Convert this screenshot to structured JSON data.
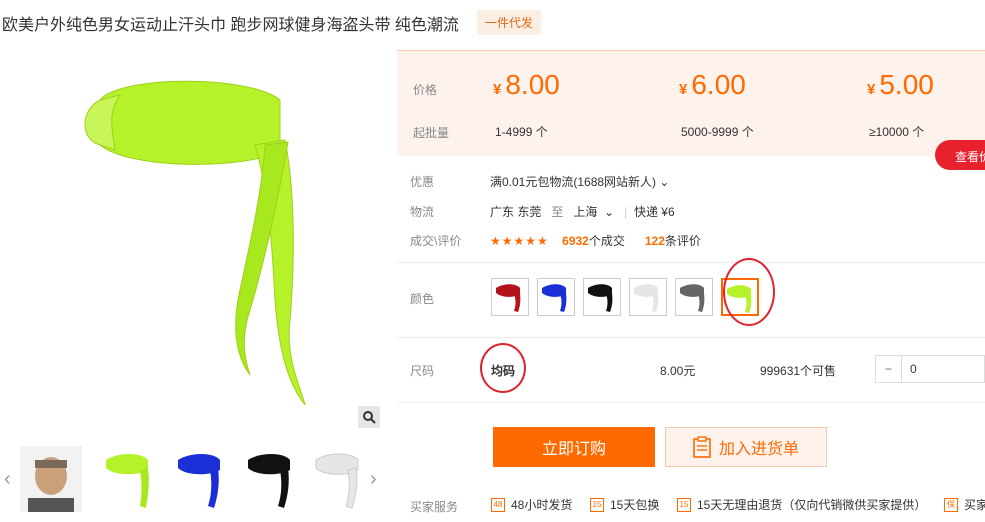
{
  "header": {
    "title": "欧美户外纯色男女运动止汗头巾 跑步网球健身海盗头带 纯色潮流",
    "badge": "一件代发"
  },
  "colors": {
    "accent": "#ff6a00",
    "highlight_circle": "#e0222d",
    "product_green": "#b6f22a"
  },
  "pricing": {
    "price_label": "价格",
    "moq_label": "起批量",
    "currency": "¥",
    "tiers": [
      {
        "price": "8.00",
        "range": "1-4999 个"
      },
      {
        "price": "6.00",
        "range": "5000-9999 个"
      },
      {
        "price": "5.00",
        "range": "≥10000 个"
      }
    ],
    "view_button": "查看价"
  },
  "info": {
    "promo_label": "优惠",
    "promo_value": "满0.01元包物流(1688网站新人)",
    "shipping_label": "物流",
    "ship_from": "广东 东莞",
    "ship_to_word": "至",
    "ship_to": "上海",
    "express": "快递 ¥6",
    "deal_label": "成交\\评价",
    "stars": "★★★★★",
    "deals_count": "6932",
    "deals_suffix": "个成交",
    "reviews_count": "122",
    "reviews_suffix": "条评价"
  },
  "color_option": {
    "label": "颜色",
    "swatches": [
      {
        "name": "red",
        "hex": "#b3141c"
      },
      {
        "name": "blue",
        "hex": "#1a2fd6"
      },
      {
        "name": "black",
        "hex": "#111111"
      },
      {
        "name": "white",
        "hex": "#e6e6e6"
      },
      {
        "name": "gray",
        "hex": "#666666"
      },
      {
        "name": "green",
        "hex": "#b6f22a"
      }
    ],
    "selected": "green"
  },
  "size_option": {
    "label": "尺码",
    "value": "均码",
    "price": "8.00元",
    "stock": "999631个可售",
    "quantity": "0",
    "minus": "−",
    "plus": "+"
  },
  "actions": {
    "order": "立即订购",
    "cart": "加入进货单"
  },
  "services": {
    "label": "买家服务",
    "items": [
      {
        "icon": "48",
        "text": "48小时发货"
      },
      {
        "icon": "15",
        "text": "15天包换"
      },
      {
        "icon": "15",
        "text": "15天无理由退货（仅向代销微供买家提供）"
      },
      {
        "icon": "保",
        "text": "买家"
      }
    ]
  },
  "gallery": {
    "thumbs": [
      {
        "name": "model",
        "hex": "#7a6a5a"
      },
      {
        "name": "green",
        "hex": "#b6f22a"
      },
      {
        "name": "blue",
        "hex": "#1a2fd6"
      },
      {
        "name": "black",
        "hex": "#111111"
      },
      {
        "name": "white",
        "hex": "#e6e6e6"
      }
    ]
  }
}
